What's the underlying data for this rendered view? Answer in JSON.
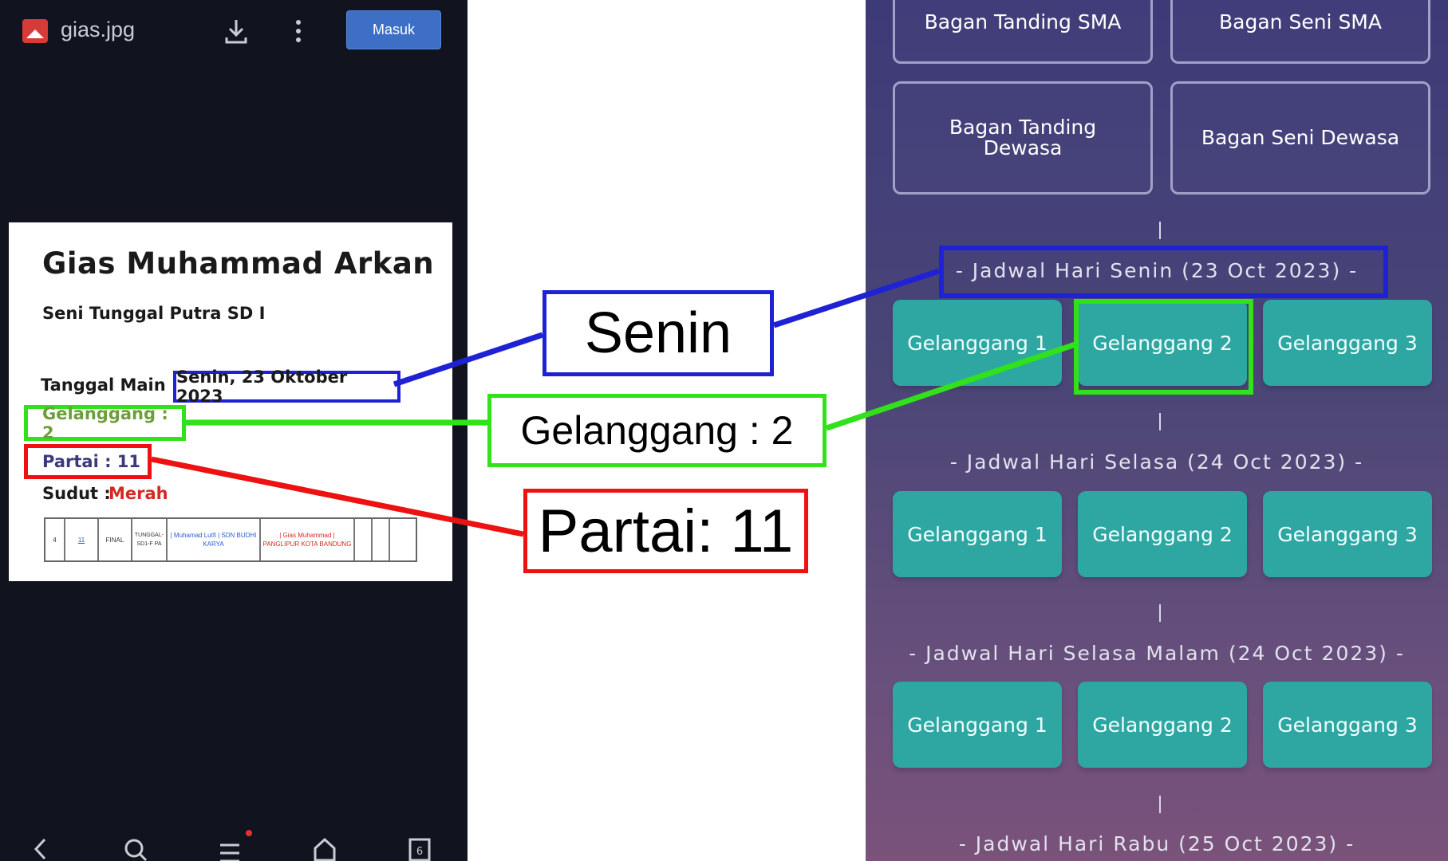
{
  "viewer": {
    "file_name": "gias.jpg",
    "login_label": "Masuk",
    "tab_count": "6"
  },
  "document": {
    "name": "Gias Muhammad Arkan",
    "category": "Seni Tunggal Putra SD I",
    "date_label": "Tanggal Main :",
    "date_value": "Senin, 23 Oktober 2023",
    "court_text": "Gelanggang : 2",
    "match_text": "Partai : 11",
    "corner_label": "Sudut :",
    "corner_value": "Merah",
    "table": {
      "no": "4",
      "match": "11",
      "round": "FINAL",
      "category": "TUNGGAL- SD1-F PA",
      "athlete_blue": "| Muhamad Lutfi | SDN BUDHI KARYA",
      "athlete_red": "| Gias Muhammad | PANGLIPUR KOTA BANDUNG"
    }
  },
  "callouts": {
    "day": "Senin",
    "court": "Gelanggang :  2",
    "match": "Partai: 11"
  },
  "schedule": {
    "top_buttons": [
      "Bagan Tanding SMA",
      "Bagan Seni SMA",
      "Bagan Tanding Dewasa",
      "Bagan Seni Dewasa"
    ],
    "days": [
      {
        "title": "- Jadwal Hari Senin (23 Oct 2023) -",
        "courts": [
          "Gelanggang 1",
          "Gelanggang 2",
          "Gelanggang 3"
        ]
      },
      {
        "title": "- Jadwal Hari Selasa (24 Oct 2023) -",
        "courts": [
          "Gelanggang 1",
          "Gelanggang 2",
          "Gelanggang 3"
        ]
      },
      {
        "title": "- Jadwal Hari Selasa Malam (24 Oct 2023) -",
        "courts": [
          "Gelanggang 1",
          "Gelanggang 2",
          "Gelanggang 3"
        ]
      },
      {
        "title": "- Jadwal Hari Rabu (25 Oct 2023) -"
      }
    ]
  },
  "colors": {
    "highlight_day": "#1f22d4",
    "highlight_court": "#31e11a",
    "highlight_match": "#ee1111",
    "court_button": "#2ea7a3"
  }
}
